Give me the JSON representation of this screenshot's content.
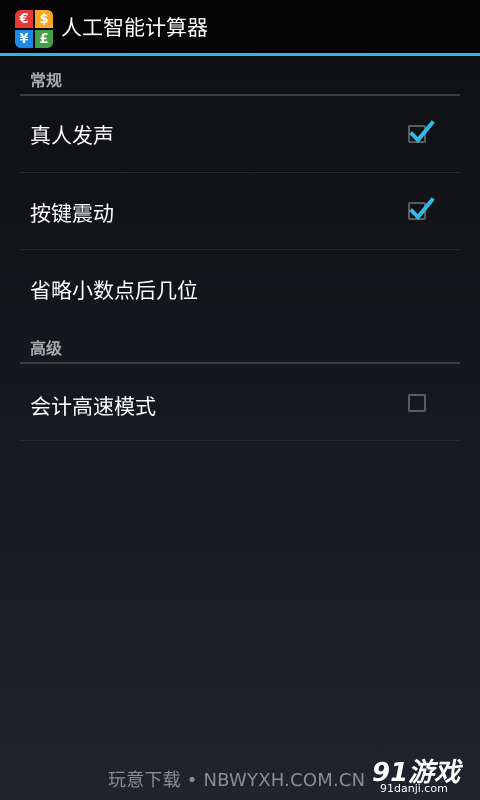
{
  "app": {
    "title": "人工智能计算器",
    "icon_glyphs": [
      "€",
      "$",
      "¥",
      "£"
    ]
  },
  "sections": [
    {
      "header": "常规",
      "items": [
        {
          "label": "真人发声",
          "checkbox": true,
          "checked": true
        },
        {
          "label": "按键震动",
          "checkbox": true,
          "checked": true
        },
        {
          "label": "省略小数点后几位",
          "checkbox": false
        }
      ]
    },
    {
      "header": "高级",
      "items": [
        {
          "label": "会计高速模式",
          "checkbox": true,
          "checked": false
        }
      ]
    }
  ],
  "watermark": {
    "text": "玩意下载 • NBWYXH.COM.CN",
    "logo_main": "91游戏",
    "logo_sub": "91danji.com"
  },
  "colors": {
    "accent": "#33b5e5",
    "section_header": "#a9abad"
  }
}
